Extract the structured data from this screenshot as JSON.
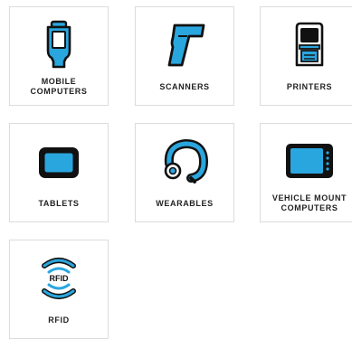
{
  "colors": {
    "accent": "#2aa6df",
    "outline": "#111111",
    "tile_border": "#dcdcdc"
  },
  "tiles": [
    {
      "label": "MOBILE\nCOMPUTERS",
      "icon": "mobile-computer-icon"
    },
    {
      "label": "SCANNERS",
      "icon": "scanner-icon"
    },
    {
      "label": "PRINTERS",
      "icon": "printer-icon"
    },
    {
      "label": "TABLETS",
      "icon": "tablet-icon"
    },
    {
      "label": "WEARABLES",
      "icon": "wearable-icon"
    },
    {
      "label": "VEHICLE MOUNT\nCOMPUTERS",
      "icon": "vehicle-mount-computer-icon"
    },
    {
      "label": "RFID",
      "icon": "rfid-icon",
      "icon_text": "RFID"
    }
  ]
}
